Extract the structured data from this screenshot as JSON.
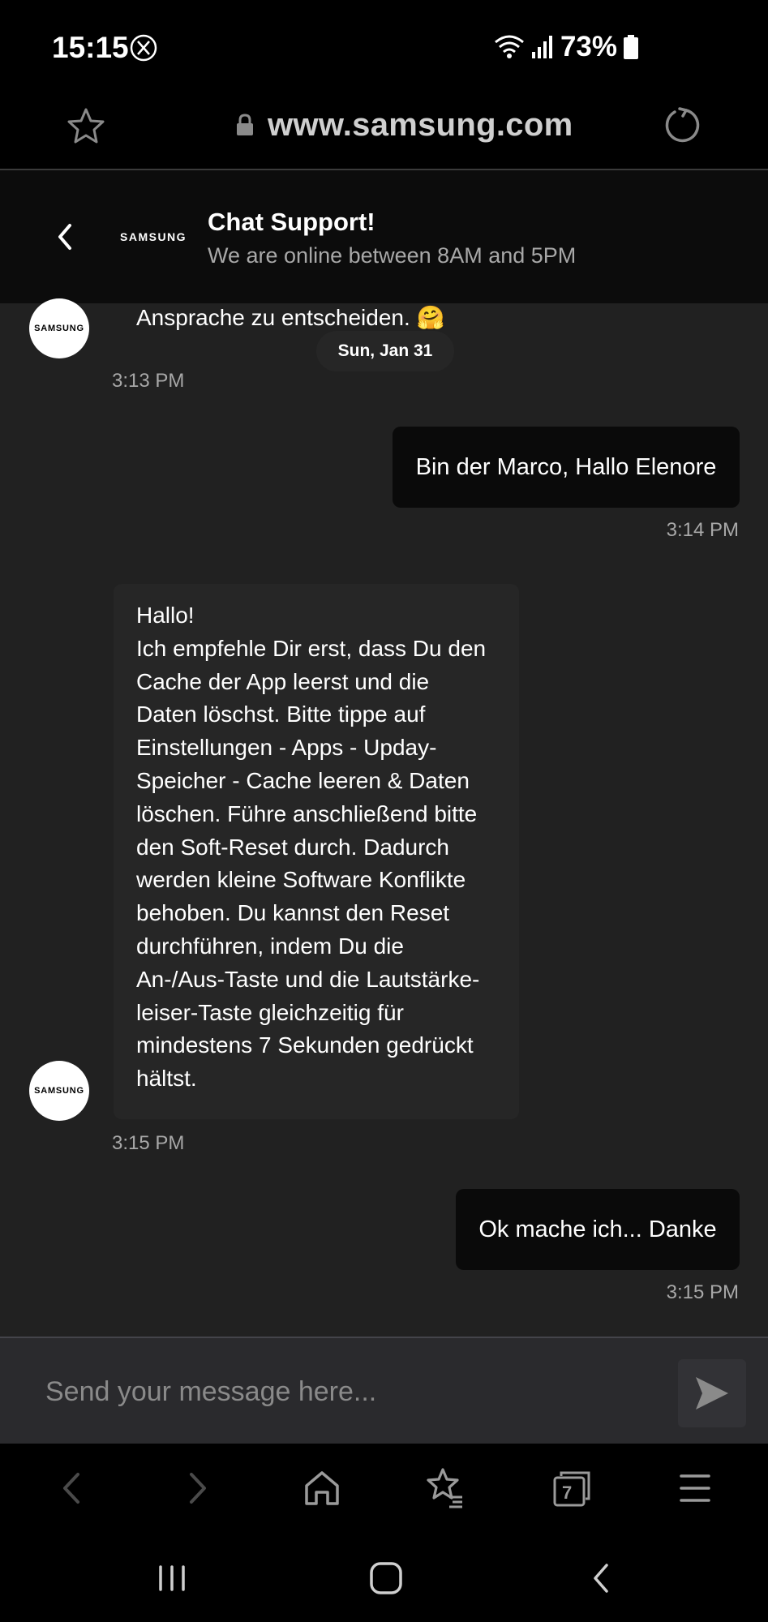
{
  "status_bar": {
    "time": "15:15",
    "battery": "73%",
    "icons": [
      "x-social-icon",
      "wifi-icon",
      "signal-icon",
      "battery-icon"
    ]
  },
  "browser": {
    "url": "www.samsung.com",
    "tab_count": "7"
  },
  "chat_header": {
    "logo": "SAMSUNG",
    "title": "Chat Support!",
    "subtitle": "We are online between 8AM and 5PM"
  },
  "date_separator": "Sun, Jan 31",
  "messages": [
    {
      "from": "agent",
      "avatar": "SAMSUNG",
      "text": "Ansprache zu entscheiden. 🤗",
      "time": "3:13 PM"
    },
    {
      "from": "user",
      "text": "Bin der Marco, Hallo Elenore",
      "time": "3:14 PM"
    },
    {
      "from": "agent",
      "avatar": "SAMSUNG",
      "text_lines": [
        "Hallo!",
        "Ich empfehle Dir erst, dass Du den",
        "Cache der App leerst und die",
        "Daten löschst. Bitte tippe auf",
        "Einstellungen - Apps - Upday-",
        "Speicher - Cache leeren & Daten",
        "löschen. Führe anschließend bitte",
        "den Soft-Reset durch. Dadurch",
        "werden kleine Software Konflikte",
        "behoben. Du kannst den Reset",
        "durchführen, indem Du die",
        "An-/Aus-Taste und die Lautstärke-",
        "leiser-Taste gleichzeitig für",
        "mindestens 7 Sekunden gedrückt",
        "hältst."
      ],
      "time": "3:15 PM"
    },
    {
      "from": "user",
      "text": "Ok mache ich... Danke",
      "time": "3:15 PM"
    }
  ],
  "input": {
    "placeholder": "Send your message here..."
  },
  "colors": {
    "background": "#212121",
    "header": "#0c0c0c",
    "user_bubble": "#0a0a0a",
    "timestamp": "#a8a8a8"
  }
}
